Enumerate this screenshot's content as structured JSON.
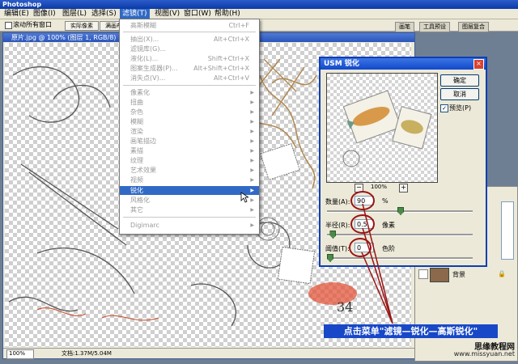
{
  "app": {
    "title": "Photoshop"
  },
  "menubar": [
    {
      "label": "编辑(E)"
    },
    {
      "label": "图像(I)"
    },
    {
      "label": "图层(L)"
    },
    {
      "label": "选择(S)"
    },
    {
      "label": "滤镜(T)"
    },
    {
      "label": "视图(V)"
    },
    {
      "label": "窗口(W)"
    },
    {
      "label": "帮助(H)"
    }
  ],
  "options": {
    "check_label": "滚动所有窗口",
    "btn1": "实际像素",
    "btn2": "满画布显示"
  },
  "palette_tabs": [
    "画笔",
    "工具预设",
    "图层复合"
  ],
  "document": {
    "title": "原片.jpg @ 100% (图层 1, RGB/8)",
    "zoom": "100%",
    "info": "文档:1.37M/5.04M"
  },
  "filter_menu": {
    "items": [
      {
        "label": "高斯模糊",
        "shortcut": "Ctrl+F"
      },
      {
        "label": "抽出(X)...",
        "shortcut": "Alt+Ctrl+X"
      },
      {
        "label": "滤镜库(G)...",
        "shortcut": ""
      },
      {
        "label": "液化(L)...",
        "shortcut": "Shift+Ctrl+X"
      },
      {
        "label": "图案生成器(P)...",
        "shortcut": "Alt+Shift+Ctrl+X"
      },
      {
        "label": "消失点(V)...",
        "shortcut": "Alt+Ctrl+V"
      },
      {
        "label": "像素化",
        "shortcut": ""
      },
      {
        "label": "扭曲",
        "shortcut": ""
      },
      {
        "label": "杂色",
        "shortcut": ""
      },
      {
        "label": "模糊",
        "shortcut": ""
      },
      {
        "label": "渲染",
        "shortcut": ""
      },
      {
        "label": "画笔描边",
        "shortcut": ""
      },
      {
        "label": "素描",
        "shortcut": ""
      },
      {
        "label": "纹理",
        "shortcut": ""
      },
      {
        "label": "艺术效果",
        "shortcut": ""
      },
      {
        "label": "视频",
        "shortcut": ""
      },
      {
        "label": "锐化",
        "shortcut": ""
      },
      {
        "label": "风格化",
        "shortcut": ""
      },
      {
        "label": "其它",
        "shortcut": ""
      },
      {
        "label": "Digimarc",
        "shortcut": ""
      }
    ]
  },
  "usm_dialog": {
    "title": "USM 锐化",
    "ok": "确定",
    "cancel": "取消",
    "preview_label": "预览(P)",
    "preview_checked": "✓",
    "preview_zoom": "100%",
    "amount_label": "数量(A):",
    "amount_value": "90",
    "amount_unit": "%",
    "radius_label": "半径(R):",
    "radius_value": "0.5",
    "radius_unit": "像素",
    "threshold_label": "阈值(T):",
    "threshold_value": "0",
    "threshold_unit": "色阶",
    "amount_level": 0.5,
    "radius_level": 0.02,
    "threshold_level": 0.0
  },
  "layers_panel": {
    "layer_name": "背景"
  },
  "callout": "点击菜单\"滤镜—锐化—高斯锐化\"",
  "watermark": {
    "site_cn": "思缘教程网",
    "site_url": "www.missyuan.net"
  },
  "colors": {
    "accent": "#316ac5",
    "dialog_border": "#0b3fb3",
    "callout": "#1848c8",
    "annotation": "#9a1414"
  }
}
